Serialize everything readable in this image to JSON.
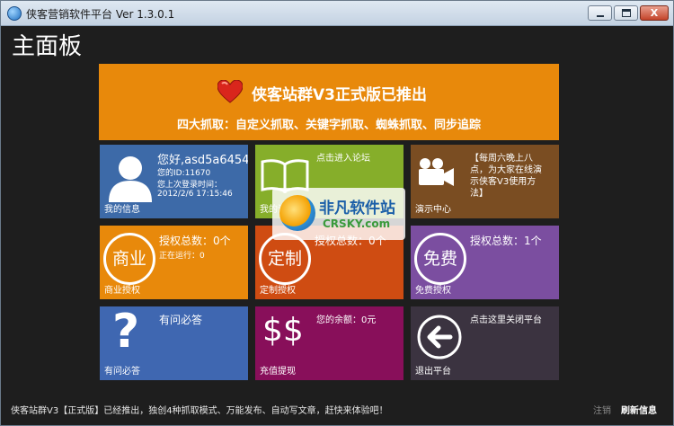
{
  "window": {
    "title": "侠客营销软件平台 Ver 1.3.0.1",
    "close_glyph": "X"
  },
  "heading": "主面板",
  "banner": {
    "title": "侠客站群V3正式版已推出",
    "subtitle": "四大抓取：自定义抓取、关键字抓取、蜘蛛抓取、同步追踪",
    "icon": "heart-icon"
  },
  "tiles": {
    "my_info": {
      "label": "我的信息",
      "greeting": "您好,asd5a6454",
      "id_line": "您的ID:11670",
      "last_login_label": "您上次登录时间：",
      "last_login_time": "2012/2/6 17:15:46"
    },
    "forum": {
      "label": "我的论坛",
      "text": "点击进入论坛"
    },
    "demo": {
      "label": "演示中心",
      "line1": "【每周六晚上八",
      "line2": "点，为大家在线演",
      "line3": "示侠客V3使用方",
      "line4": "法】"
    },
    "business": {
      "label": "商业授权",
      "badge": "商业",
      "count": "授权总数：0个",
      "running": "正在运行：0"
    },
    "custom": {
      "label": "定制授权",
      "badge": "定制",
      "count": "授权总数：0个"
    },
    "free": {
      "label": "免费授权",
      "badge": "免费",
      "count": "授权总数：1个"
    },
    "faq": {
      "label": "有问必答",
      "glyph": "?",
      "text": "有问必答"
    },
    "recharge": {
      "label": "充值提现",
      "glyph": "$$",
      "balance": "您的余额：0元"
    },
    "exit": {
      "label": "退出平台",
      "text": "点击这里关闭平台"
    }
  },
  "watermark": {
    "text": "非凡软件站",
    "sub": "CRSKY.com"
  },
  "status": {
    "text": "侠客站群V3【正式版】已经推出，独创4种抓取模式、万能发布、自动写文章，赶快来体验吧！",
    "logout": "注销",
    "refresh": "刷新信息"
  },
  "colors": {
    "orange": "#e8890b",
    "blue": "#3d6aa8",
    "olive": "#86ae2a",
    "brown": "#7a4d22",
    "red": "#cf4c12",
    "purple": "#7b4ea0",
    "magenta": "#880f5a",
    "dark": "#3b3340"
  }
}
